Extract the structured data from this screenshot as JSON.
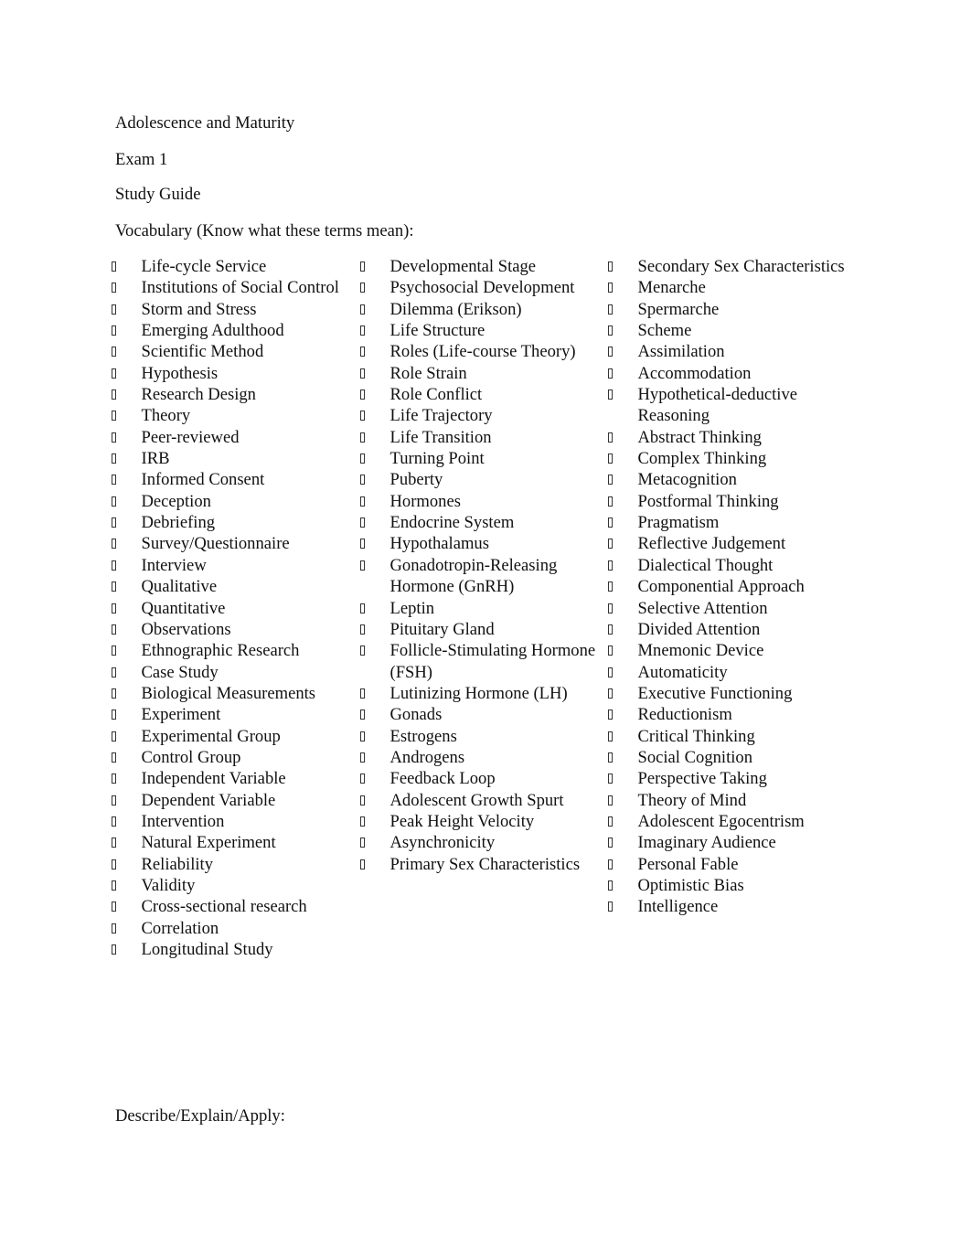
{
  "document": {
    "title": "Adolescence and Maturity",
    "exam": "Exam 1",
    "subtitle": "Study Guide",
    "vocabulary_heading": "Vocabulary (Know what these terms mean):",
    "bullet_icon": "missing-glyph-box",
    "vocabulary_columns": [
      {
        "terms": [
          "Life-cycle Service",
          "Institutions of Social Control",
          "Storm and Stress",
          "Emerging Adulthood",
          "Scientific Method",
          "Hypothesis",
          "Research Design",
          "Theory",
          "Peer-reviewed",
          "IRB",
          "Informed Consent",
          "Deception",
          "Debriefing",
          "Survey/Questionnaire",
          "Interview",
          "Qualitative",
          "Quantitative",
          "Observations",
          "Ethnographic Research",
          "Case Study",
          "Biological Measurements",
          "Experiment",
          "Experimental Group",
          "Control Group",
          "Independent Variable",
          "Dependent Variable",
          "Intervention",
          "Natural Experiment",
          "Reliability",
          "Validity",
          "Cross-sectional research",
          "Correlation",
          "Longitudinal Study"
        ]
      },
      {
        "terms": [
          "Developmental Stage",
          "Psychosocial Development",
          "Dilemma (Erikson)",
          "Life Structure",
          "Roles (Life-course Theory)",
          "Role Strain",
          "Role Conflict",
          "Life Trajectory",
          "Life Transition",
          "Turning Point",
          "Puberty",
          "Hormones",
          "Endocrine System",
          "Hypothalamus",
          "Gonadotropin-Releasing Hormone (GnRH)",
          "Leptin",
          "Pituitary Gland",
          "Follicle-Stimulating Hormone (FSH)",
          "Lutinizing Hormone (LH)",
          "Gonads",
          "Estrogens",
          "Androgens",
          "Feedback Loop",
          "Adolescent Growth Spurt",
          "Peak Height Velocity",
          "Asynchronicity",
          "Primary Sex Characteristics"
        ]
      },
      {
        "terms": [
          "Secondary Sex Characteristics",
          "Menarche",
          "Spermarche",
          "Scheme",
          "Assimilation",
          "Accommodation",
          "Hypothetical-deductive Reasoning",
          "Abstract Thinking",
          "Complex Thinking",
          "Metacognition",
          "Postformal Thinking",
          "Pragmatism",
          "Reflective Judgement",
          "Dialectical Thought",
          "Componential Approach",
          "Selective Attention",
          "Divided Attention",
          "Mnemonic Device",
          "Automaticity",
          "Executive Functioning",
          "Reductionism",
          "Critical Thinking",
          "Social Cognition",
          "Perspective Taking",
          "Theory of Mind",
          "Adolescent Egocentrism",
          "Imaginary Audience",
          "Personal Fable",
          "Optimistic Bias",
          "Intelligence"
        ]
      }
    ],
    "describe_heading": "Describe/Explain/Apply:"
  }
}
